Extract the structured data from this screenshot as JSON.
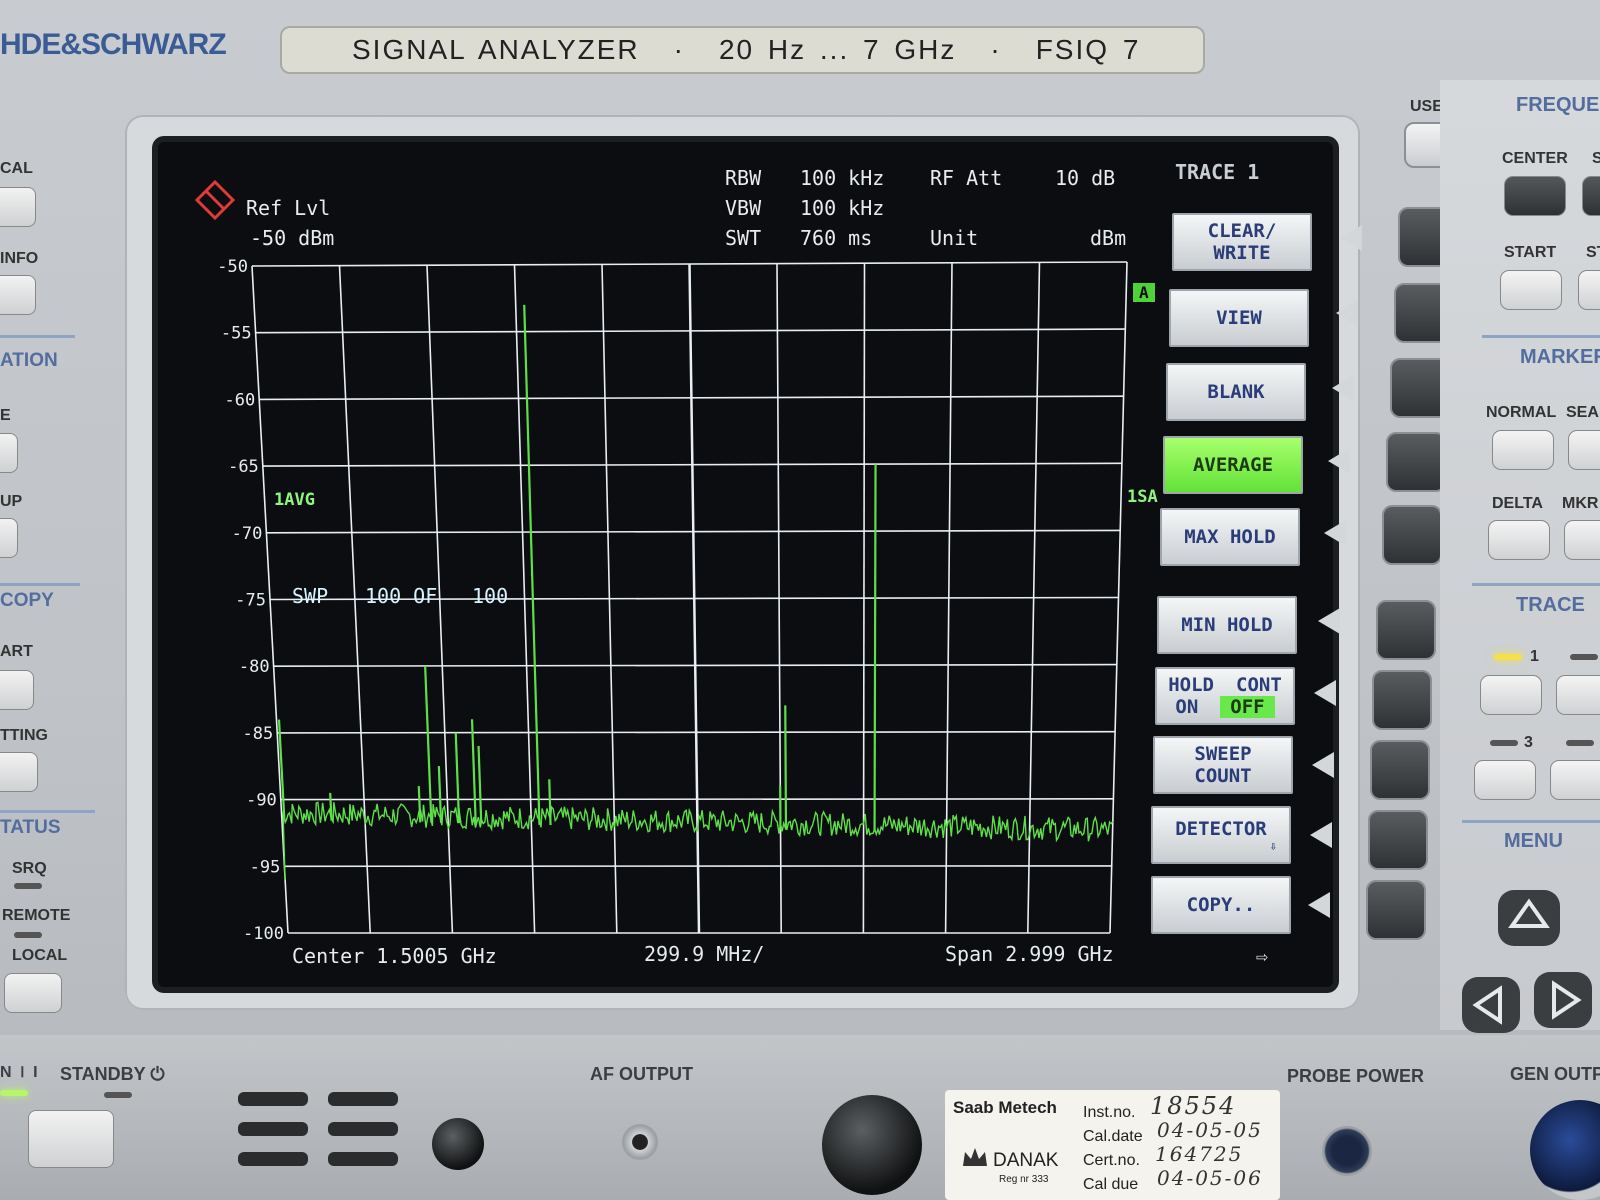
{
  "device": {
    "brand": "HDE&SCHWARZ",
    "model_plate": [
      "SIGNAL ANALYZER",
      "·",
      "20 Hz ... 7 GHz",
      "·",
      "FSIQ 7"
    ]
  },
  "left_panel": {
    "labels": [
      "CAL",
      "INFO",
      "ATION",
      "E",
      "UP",
      "COPY",
      "ART",
      "TTING",
      "TATUS",
      "SRQ",
      "REMOTE",
      "LOCAL"
    ]
  },
  "screen": {
    "ref_label": "Ref Lvl",
    "ref_value": "-50 dBm",
    "rbw_label": "RBW",
    "rbw_value": "100 kHz",
    "vbw_label": "VBW",
    "vbw_value": "100 kHz",
    "swt_label": "SWT",
    "swt_value": "760 ms",
    "rfatt_label": "RF Att",
    "rfatt_value": "10 dB",
    "unit_label": "Unit",
    "unit_value": "dBm",
    "trace_title": "TRACE 1",
    "marker_a": "A",
    "avg_label": "1AVG",
    "sa_label": "1SA",
    "swp_label": "SWP",
    "swp_count": "100 OF",
    "swp_total": "100",
    "center": "Center 1.5005 GHz",
    "per_div": "299.9 MHz/",
    "span": "Span 2.999 GHz",
    "arrow": "⇨"
  },
  "chart_data": {
    "type": "line",
    "xlabel": "",
    "ylabel": "",
    "center_ghz": 1.5005,
    "span_ghz": 2.999,
    "ylim": [
      -100,
      -50
    ],
    "yticks": [
      -50,
      -55,
      -60,
      -65,
      -70,
      -75,
      -80,
      -85,
      -90,
      -95,
      -100
    ],
    "grid": true,
    "noise_floor_dbm": -91,
    "series": [
      {
        "peaks": [
          {
            "freq_ghz": 0.01,
            "level_dbm": -84
          },
          {
            "freq_ghz": 0.18,
            "level_dbm": -89.5
          },
          {
            "freq_ghz": 0.5,
            "level_dbm": -89
          },
          {
            "freq_ghz": 0.54,
            "level_dbm": -80
          },
          {
            "freq_ghz": 0.575,
            "level_dbm": -87.5
          },
          {
            "freq_ghz": 0.64,
            "level_dbm": -85
          },
          {
            "freq_ghz": 0.7,
            "level_dbm": -84
          },
          {
            "freq_ghz": 0.72,
            "level_dbm": -86
          },
          {
            "freq_ghz": 0.93,
            "level_dbm": -53
          },
          {
            "freq_ghz": 0.97,
            "level_dbm": -88.5
          },
          {
            "freq_ghz": 1.8,
            "level_dbm": -89
          },
          {
            "freq_ghz": 1.82,
            "level_dbm": -83
          },
          {
            "freq_ghz": 2.14,
            "level_dbm": -65
          }
        ]
      }
    ]
  },
  "softkeys": {
    "clear_write": [
      "CLEAR/",
      "WRITE"
    ],
    "view": "VIEW",
    "blank": "BLANK",
    "average": "AVERAGE",
    "max_hold": "MAX HOLD",
    "min_hold": "MIN HOLD",
    "hold_cont": [
      "HOLD",
      "CONT"
    ],
    "hold_on": "ON",
    "hold_off": "OFF",
    "sweep_count": [
      "SWEEP",
      "COUNT"
    ],
    "detector": "DETECTOR",
    "detector_arrow": "⇩",
    "copy": "COPY.."
  },
  "right_panel": {
    "user": "USER",
    "frequency": "FREQUE",
    "center": "CENTER",
    "s": "S",
    "start": "START",
    "st": "ST",
    "marker": "MARKER",
    "normal": "NORMAL",
    "sea": "SEA",
    "delta": "DELTA",
    "mkr": "MKR",
    "trace": "TRACE",
    "trace1": "1",
    "trace3": "3",
    "menu": "MENU"
  },
  "bottom": {
    "power_mark": "N ⏽ I",
    "standby": "STANDBY ⏻",
    "af_output": "AF OUTPUT",
    "probe_power": "PROBE POWER",
    "gen_output": "GEN OUTP"
  },
  "cal_label": {
    "company": "Saab Metech",
    "inst_no_label": "Inst.no.",
    "inst_no": "18554",
    "cal_date_label": "Cal.date",
    "cal_date": "04-05-05",
    "cert_no_label": "Cert.no.",
    "cert_no": "164725",
    "cal_due_label": "Cal due",
    "cal_due": "04-05-06",
    "danak": "DANAK",
    "reg": "Reg nr 333"
  }
}
